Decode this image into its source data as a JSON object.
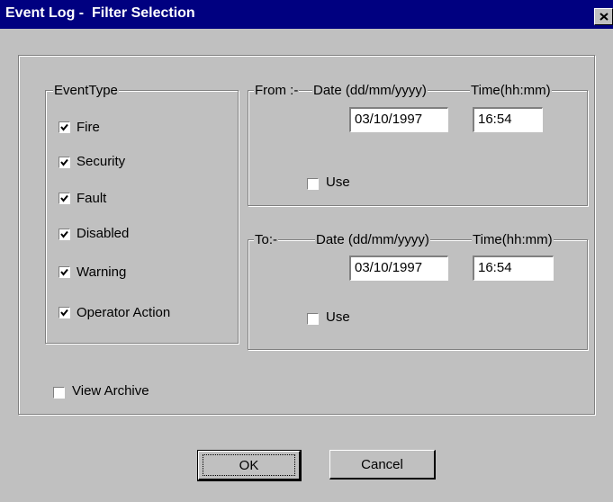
{
  "window": {
    "title": "Event Log -  Filter Selection",
    "close_icon": "close-icon"
  },
  "event_type": {
    "legend": "EventType",
    "items": [
      {
        "label": "Fire",
        "checked": true
      },
      {
        "label": "Security",
        "checked": true
      },
      {
        "label": "Fault",
        "checked": true
      },
      {
        "label": "Disabled",
        "checked": true
      },
      {
        "label": "Warning",
        "checked": true
      },
      {
        "label": "Operator Action",
        "checked": true
      }
    ]
  },
  "from": {
    "legend": "From :-",
    "date_label": "Date (dd/mm/yyyy)",
    "time_label": "Time(hh:mm)",
    "date_value": "03/10/1997",
    "time_value": "16:54",
    "use_label": "Use",
    "use_checked": false
  },
  "to": {
    "legend": "To:-",
    "date_label": "Date (dd/mm/yyyy)",
    "time_label": "Time(hh:mm)",
    "date_value": "03/10/1997",
    "time_value": "16:54",
    "use_label": "Use",
    "use_checked": false
  },
  "view_archive": {
    "label": "View Archive",
    "checked": false
  },
  "buttons": {
    "ok": "OK",
    "cancel": "Cancel"
  },
  "colors": {
    "face": "#c0c0c0",
    "titlebar": "#000080",
    "title_text": "#ffffff"
  }
}
